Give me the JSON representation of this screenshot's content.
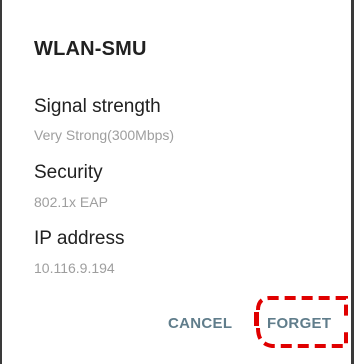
{
  "dialog": {
    "title": "WLAN-SMU",
    "fields": [
      {
        "label": "Signal strength",
        "value": "Very Strong(300Mbps)"
      },
      {
        "label": "Security",
        "value": "802.1x EAP"
      },
      {
        "label": "IP address",
        "value": "10.116.9.194"
      }
    ],
    "buttons": {
      "cancel_label": "CANCEL",
      "forget_label": "FORGET"
    }
  },
  "colors": {
    "title_text": "#212121",
    "secondary_text": "#9e9e9e",
    "button_text": "#607d8b",
    "highlight": "#e00000"
  }
}
